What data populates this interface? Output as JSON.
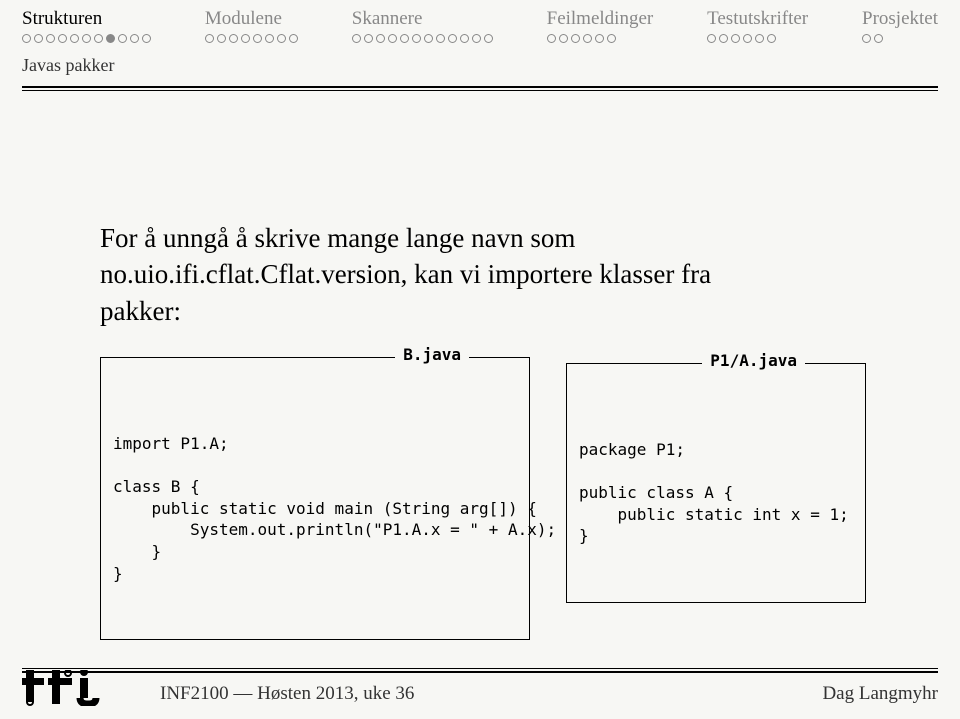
{
  "nav": {
    "items": [
      {
        "label": "Strukturen",
        "dots": 11,
        "filled_index": 7,
        "current": true
      },
      {
        "label": "Modulene",
        "dots": 8,
        "filled_index": -1,
        "current": false
      },
      {
        "label": "Skannere",
        "dots": 12,
        "filled_index": -1,
        "current": false
      },
      {
        "label": "Feilmeldinger",
        "dots": 6,
        "filled_index": -1,
        "current": false
      },
      {
        "label": "Testutskrifter",
        "dots": 6,
        "filled_index": -1,
        "current": false
      },
      {
        "label": "Prosjektet",
        "dots": 2,
        "filled_index": -1,
        "current": false
      }
    ]
  },
  "subtitle": "Javas pakker",
  "lead": {
    "line1": "For å unngå å skrive mange lange navn som",
    "line2": "no.uio.ifi.cflat.Cflat.version, kan vi importere klasser fra",
    "line3": "pakker:"
  },
  "code_left": {
    "tag": "B.java",
    "body": "import P1.A;\n\nclass B {\n    public static void main (String arg[]) {\n        System.out.println(\"P1.A.x = \" + A.x);\n    }\n}"
  },
  "code_right": {
    "tag": "P1/A.java",
    "body": "package P1;\n\npublic class A {\n    public static int x = 1;\n}"
  },
  "footer": {
    "left": "INF2100 — Høsten 2013, uke 36",
    "right": "Dag Langmyhr"
  }
}
